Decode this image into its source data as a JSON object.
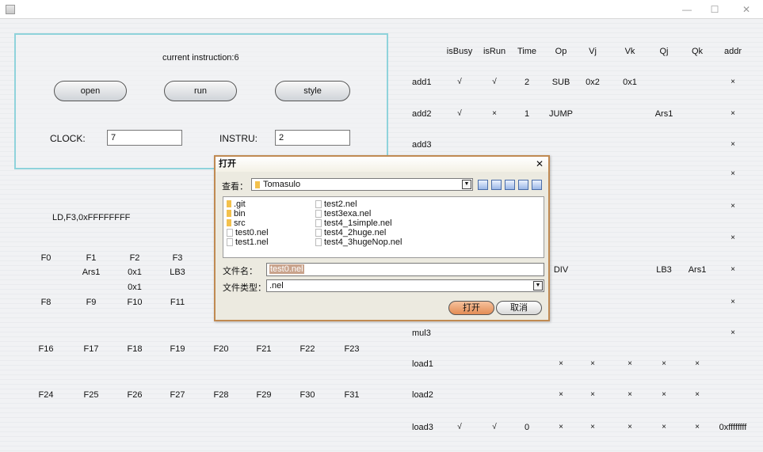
{
  "window": {
    "minimize": "—",
    "maximize": "☐",
    "close": "✕"
  },
  "control": {
    "current_instruction": "current instruction:6",
    "open_label": "open",
    "run_label": "run",
    "style_label": "style",
    "clock_label": "CLOCK:",
    "clock_value": "7",
    "instru_label": "INSTRU:",
    "instru_value": "2"
  },
  "instruction_text": "LD,F3,0xFFFFFFFF",
  "registers": {
    "row1_names": [
      "F0",
      "F1",
      "F2",
      "F3"
    ],
    "row1_values": [
      "",
      "Ars1",
      "0x1",
      "LB3"
    ],
    "row1_values2": [
      "",
      "",
      "0x1",
      ""
    ],
    "row2_names": [
      "F8",
      "F9",
      "F10",
      "F11"
    ],
    "row3_names": [
      "F16",
      "F17",
      "F18",
      "F19",
      "F20",
      "F21",
      "F22",
      "F23"
    ],
    "row4_names": [
      "F24",
      "F25",
      "F26",
      "F27",
      "F28",
      "F29",
      "F30",
      "F31"
    ]
  },
  "station": {
    "headers": [
      "isBusy",
      "isRun",
      "Time",
      "Op",
      "Vj",
      "Vk",
      "Qj",
      "Qk",
      "addr"
    ],
    "rows": [
      {
        "name": "add1",
        "cells": [
          "√",
          "√",
          "2",
          "SUB",
          "0x2",
          "0x1",
          "",
          "",
          "×"
        ]
      },
      {
        "name": "add2",
        "cells": [
          "√",
          "×",
          "1",
          "JUMP",
          "",
          "",
          "Ars1",
          "",
          "×"
        ]
      },
      {
        "name": "add3",
        "cells": [
          "",
          "",
          "",
          "",
          "",
          "",
          "",
          "",
          "×"
        ]
      },
      {
        "name": "",
        "cells": [
          "",
          "",
          "",
          "",
          "",
          "",
          "",
          "",
          "×"
        ]
      },
      {
        "name": "",
        "cells": [
          "",
          "",
          "",
          "",
          "",
          "",
          "",
          "",
          "×"
        ]
      },
      {
        "name": "",
        "cells": [
          "",
          "",
          "",
          "",
          "",
          "",
          "",
          "",
          "×"
        ]
      },
      {
        "name": "",
        "cells": [
          "",
          "",
          "",
          "DIV",
          "",
          "",
          "LB3",
          "Ars1",
          "×"
        ]
      },
      {
        "name": "",
        "cells": [
          "",
          "",
          "",
          "",
          "",
          "",
          "",
          "",
          "×"
        ]
      },
      {
        "name": "mul3",
        "cells": [
          "",
          "",
          "",
          "",
          "",
          "",
          "",
          "",
          "×"
        ]
      },
      {
        "name": "load1",
        "cells": [
          "",
          "",
          "",
          "×",
          "×",
          "×",
          "×",
          "×",
          ""
        ]
      },
      {
        "name": "load2",
        "cells": [
          "",
          "",
          "",
          "×",
          "×",
          "×",
          "×",
          "×",
          ""
        ]
      },
      {
        "name": "load3",
        "cells": [
          "√",
          "√",
          "0",
          "×",
          "×",
          "×",
          "×",
          "×",
          "0xffffffff"
        ]
      }
    ]
  },
  "dialog": {
    "title": "打开",
    "close": "✕",
    "look_in_label": "查看：",
    "look_in_value": "Tomasulo",
    "files_col1": [
      {
        "name": ".git",
        "type": "folder"
      },
      {
        "name": "bin",
        "type": "folder"
      },
      {
        "name": "src",
        "type": "folder"
      },
      {
        "name": "test0.nel",
        "type": "file"
      },
      {
        "name": "test1.nel",
        "type": "file"
      }
    ],
    "files_col2": [
      {
        "name": "test2.nel",
        "type": "file"
      },
      {
        "name": "test3exa.nel",
        "type": "file"
      },
      {
        "name": "test4_1simple.nel",
        "type": "file"
      },
      {
        "name": "test4_2huge.nel",
        "type": "file"
      },
      {
        "name": "test4_3hugeNop.nel",
        "type": "file"
      }
    ],
    "filename_label": "文件名：",
    "filename_value": "test0.nel",
    "filetype_label": "文件类型：",
    "filetype_value": ".nel",
    "open_label": "打开",
    "cancel_label": "取消"
  },
  "colors": {
    "panel_border": "#8fd3db",
    "dialog_border": "#c08a52",
    "open_button": "#e9a070"
  }
}
